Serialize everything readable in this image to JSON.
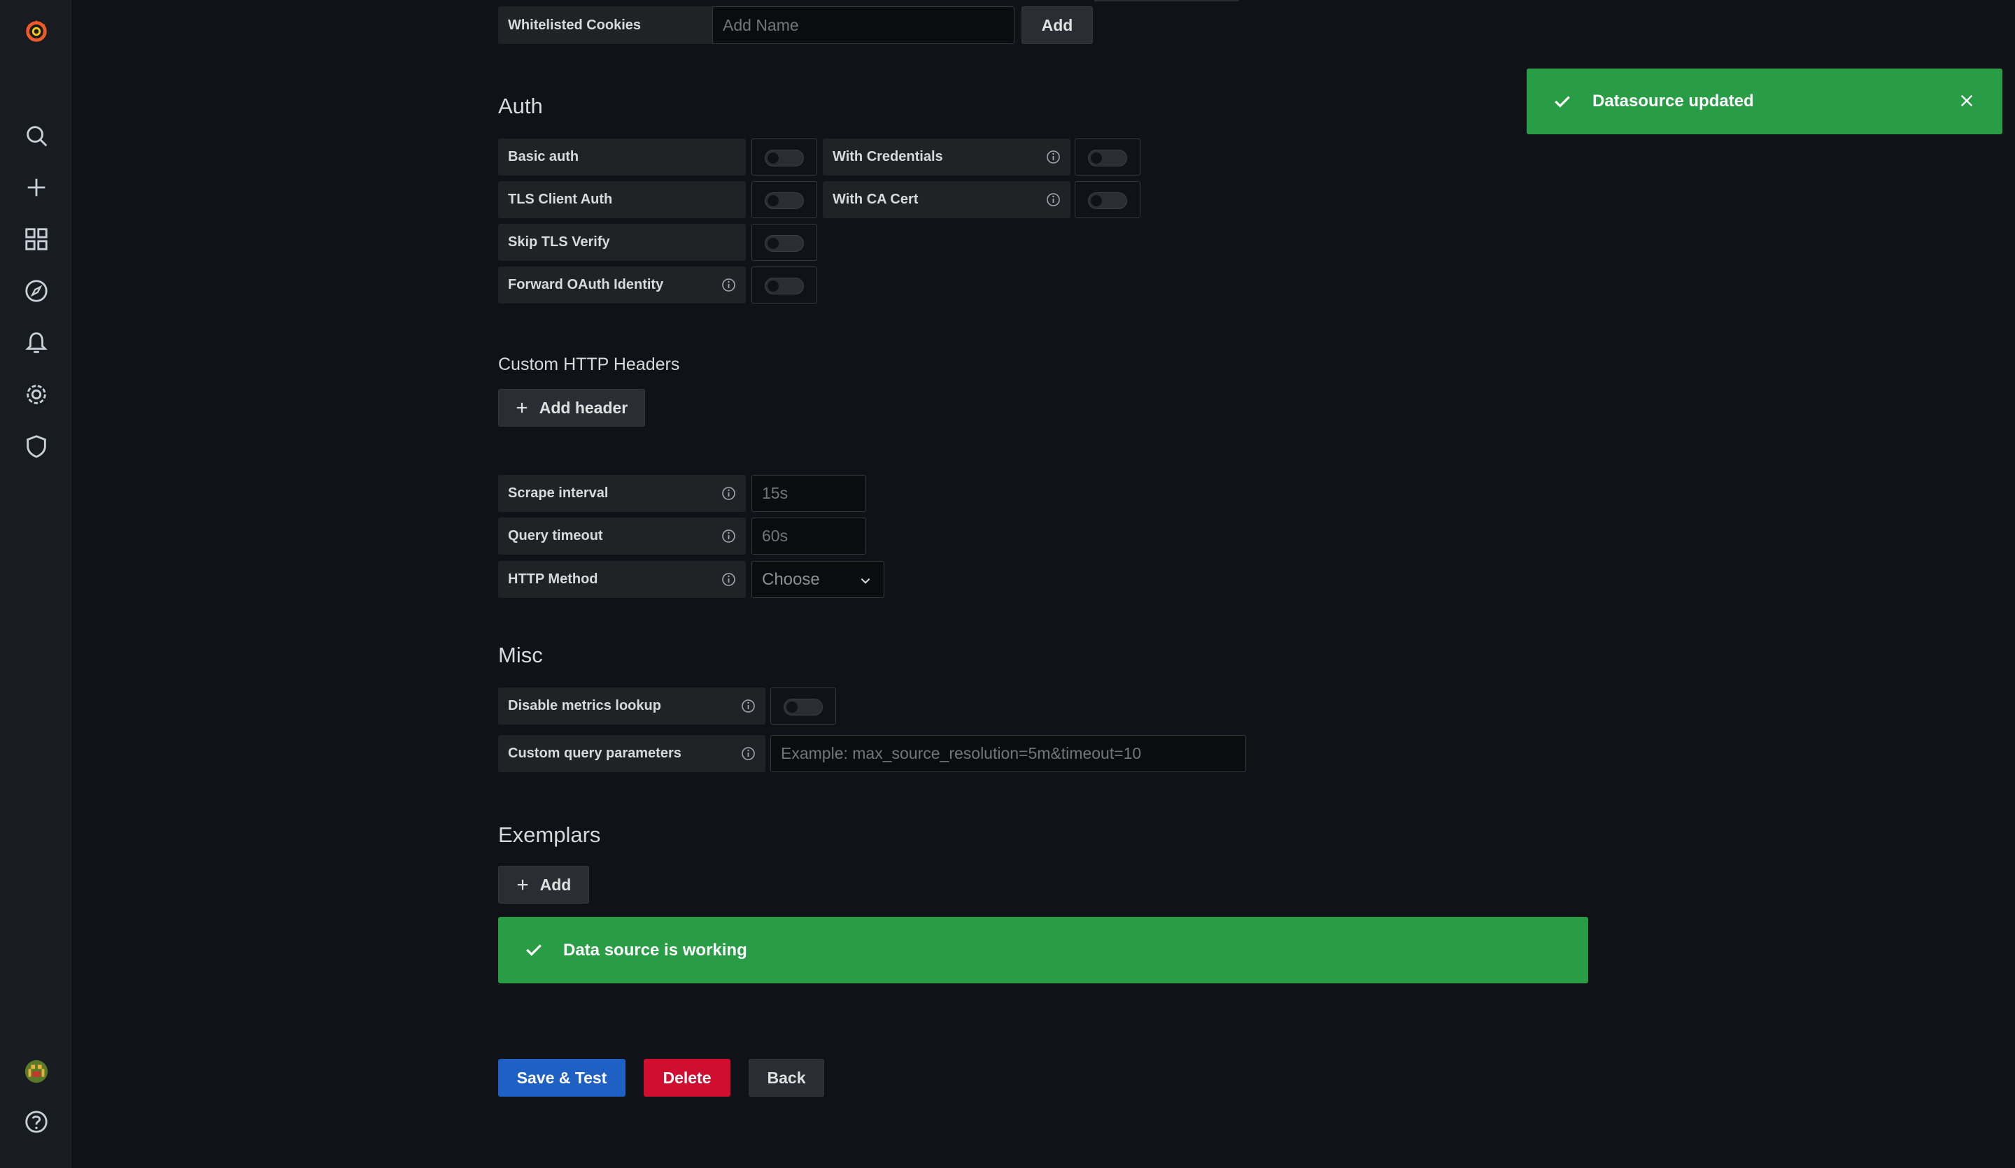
{
  "whitelisted_cookies": {
    "label": "Whitelisted Cookies",
    "placeholder": "Add Name",
    "add_label": "Add"
  },
  "auth": {
    "title": "Auth",
    "basic_auth": "Basic auth",
    "with_credentials": "With Credentials",
    "tls_client_auth": "TLS Client Auth",
    "with_ca_cert": "With CA Cert",
    "skip_tls_verify": "Skip TLS Verify",
    "forward_oauth": "Forward OAuth Identity"
  },
  "custom_headers": {
    "title": "Custom HTTP Headers",
    "add_label": "Add header"
  },
  "prometheus": {
    "scrape_interval_label": "Scrape interval",
    "scrape_interval_placeholder": "15s",
    "query_timeout_label": "Query timeout",
    "query_timeout_placeholder": "60s",
    "http_method_label": "HTTP Method",
    "http_method_value": "Choose"
  },
  "misc": {
    "title": "Misc",
    "disable_metrics_label": "Disable metrics lookup",
    "custom_query_label": "Custom query parameters",
    "custom_query_placeholder": "Example: max_source_resolution=5m&timeout=10"
  },
  "exemplars": {
    "title": "Exemplars",
    "add_label": "Add"
  },
  "status": {
    "working_text": "Data source is working",
    "toast_text": "Datasource updated"
  },
  "actions": {
    "save_test": "Save & Test",
    "delete": "Delete",
    "back": "Back"
  },
  "colors": {
    "success": "#299c46",
    "primary": "#1f60c4",
    "danger": "#d10e2f",
    "brand": "#f05a28"
  },
  "icons": [
    "grafana-logo-icon",
    "search-icon",
    "plus-icon",
    "dashboards-icon",
    "explore-icon",
    "alerting-icon",
    "gear-icon",
    "shield-icon",
    "avatar",
    "help-icon",
    "info-icon",
    "check-icon",
    "close-icon",
    "chevron-down-icon"
  ]
}
